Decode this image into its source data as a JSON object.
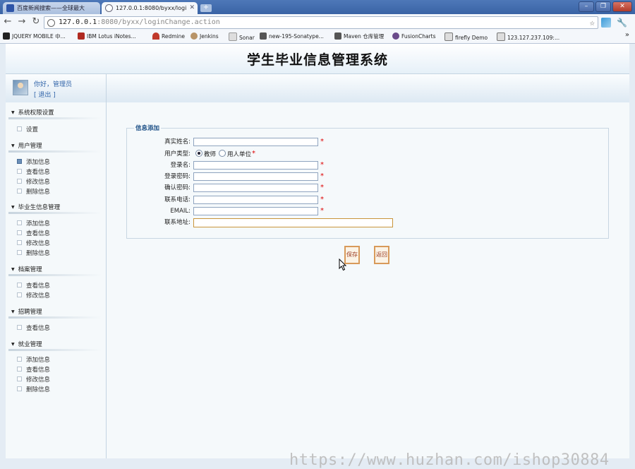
{
  "browser": {
    "tabs": [
      {
        "label": "百度新闻搜索——全球最大",
        "active": false
      },
      {
        "label": "127.0.0.1:8080/byxx/logi",
        "active": true
      }
    ],
    "url_host": "127.0.0.1",
    "url_rest": ":8080/byxx/loginChange.action",
    "bookmarks": [
      "JQUERY MOBILE 中...",
      "IBM Lotus iNotes...",
      "Redmine",
      "Jenkins",
      "Sonar",
      "new-195-Sonatype...",
      "Maven 仓库管理",
      "FusionCharts",
      "firefly Demo",
      "123.127.237.109:..."
    ]
  },
  "header": {
    "title": "学生毕业信息管理系统"
  },
  "user": {
    "greeting": "你好，管理员",
    "logout": "[ 退出 ]"
  },
  "sidebar": {
    "sections": [
      {
        "title": "系统权限设置",
        "items": [
          "设置"
        ]
      },
      {
        "title": "用户管理",
        "items": [
          "添加信息",
          "查看信息",
          "修改信息",
          "删除信息"
        ]
      },
      {
        "title": "毕业生信息管理",
        "items": [
          "添加信息",
          "查看信息",
          "修改信息",
          "删除信息"
        ]
      },
      {
        "title": "档案管理",
        "items": [
          "查看信息",
          "修改信息"
        ]
      },
      {
        "title": "招聘管理",
        "items": [
          "查看信息"
        ]
      },
      {
        "title": "就业管理",
        "items": [
          "添加信息",
          "查看信息",
          "修改信息",
          "删除信息"
        ]
      }
    ]
  },
  "form": {
    "legend": "信息添加",
    "fields": {
      "realname": {
        "label": "真实姓名:",
        "value": ""
      },
      "usertype": {
        "label": "用户类型:",
        "options": [
          "教师",
          "用人单位"
        ],
        "selected": "教师"
      },
      "loginname": {
        "label": "登录名:",
        "value": ""
      },
      "password": {
        "label": "登录密码:",
        "value": ""
      },
      "confirm": {
        "label": "确认密码:",
        "value": ""
      },
      "phone": {
        "label": "联系电话:",
        "value": ""
      },
      "email": {
        "label": "EMAIL:",
        "value": ""
      },
      "address": {
        "label": "联系地址:",
        "value": ""
      }
    },
    "required_mark": "*",
    "save": "保存",
    "back": "返回"
  },
  "watermark": "https://www.huzhan.com/ishop30884"
}
